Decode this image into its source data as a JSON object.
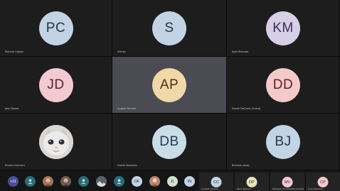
{
  "tiles": [
    {
      "initials": "PC",
      "name": "Patricia Cobain",
      "bg": "#c2d3e4",
      "fg": "#24364a"
    },
    {
      "initials": "S",
      "name": "Shirley",
      "bg": "#c2d3e4",
      "fg": "#24364a"
    },
    {
      "initials": "KM",
      "name": "Kyle Matsuda",
      "bg": "#d6cfe6",
      "fg": "#3b2f58"
    },
    {
      "initials": "JD",
      "name": "Jess Denter",
      "bg": "#f3c9d2",
      "fg": "#5a2232"
    },
    {
      "initials": "AP",
      "name": "Angela Pohmer",
      "bg": "#f2d7a8",
      "fg": "#4a3212"
    },
    {
      "initials": "DD",
      "name": "Daniel DeCarlo (Guest)",
      "bg": "#f3c9c9",
      "fg": "#5a2222"
    },
    {
      "initials": "",
      "name": "Emma Guerrero",
      "bg": "#d8d6d4",
      "fg": "#333333"
    },
    {
      "initials": "DB",
      "name": "Daniel Bourdain",
      "bg": "#c9dde7",
      "fg": "#23404e"
    },
    {
      "initials": "BJ",
      "name": "Brendan Josay",
      "bg": "#c2d3e4",
      "fg": "#24364a"
    }
  ],
  "bar": {
    "more_label": "+31",
    "items": [
      {
        "initials": "",
        "type": "icon"
      },
      {
        "initials": "",
        "type": "photo"
      },
      {
        "initials": "",
        "type": "photo"
      },
      {
        "initials": "",
        "type": "icon"
      },
      {
        "initials": "",
        "type": "photo"
      },
      {
        "initials": "",
        "type": "icon"
      },
      {
        "initials": "DF",
        "type": "avatar",
        "bg": "#c2d3e4"
      },
      {
        "initials": "",
        "type": "photo"
      },
      {
        "initials": "JL",
        "type": "avatar",
        "bg": "#cfe3cf"
      },
      {
        "initials": "IN",
        "type": "avatar",
        "bg": "#c2d3e4"
      }
    ],
    "wide": [
      {
        "initials": "CC",
        "name": "Cynthia Carlisle",
        "bg": "#c2d3e4"
      },
      {
        "initials": "DP",
        "name": "Dana Pierson",
        "bg": "#e8e2b8"
      },
      {
        "initials": "MV",
        "name": "Makayla Vanderhaald (Guest)",
        "bg": "#f3c9d2"
      },
      {
        "initials": "CP",
        "name": "Cory Peterson",
        "bg": "#f3c9c9"
      }
    ]
  }
}
